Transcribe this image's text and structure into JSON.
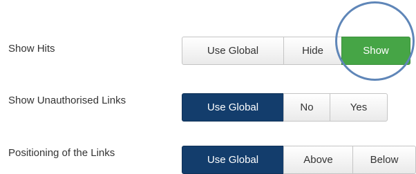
{
  "rows": [
    {
      "label": "Show Hits",
      "options": [
        "Use Global",
        "Hide",
        "Show"
      ],
      "selected": "Show",
      "selected_color": "#46a546"
    },
    {
      "label": "Show Unauthorised Links",
      "options": [
        "Use Global",
        "No",
        "Yes"
      ],
      "selected": "Use Global",
      "selected_color": "#133d6c"
    },
    {
      "label": "Positioning of the Links",
      "options": [
        "Use Global",
        "Above",
        "Below"
      ],
      "selected": "Use Global",
      "selected_color": "#133d6c"
    }
  ],
  "highlight_color": "#5f86b8"
}
